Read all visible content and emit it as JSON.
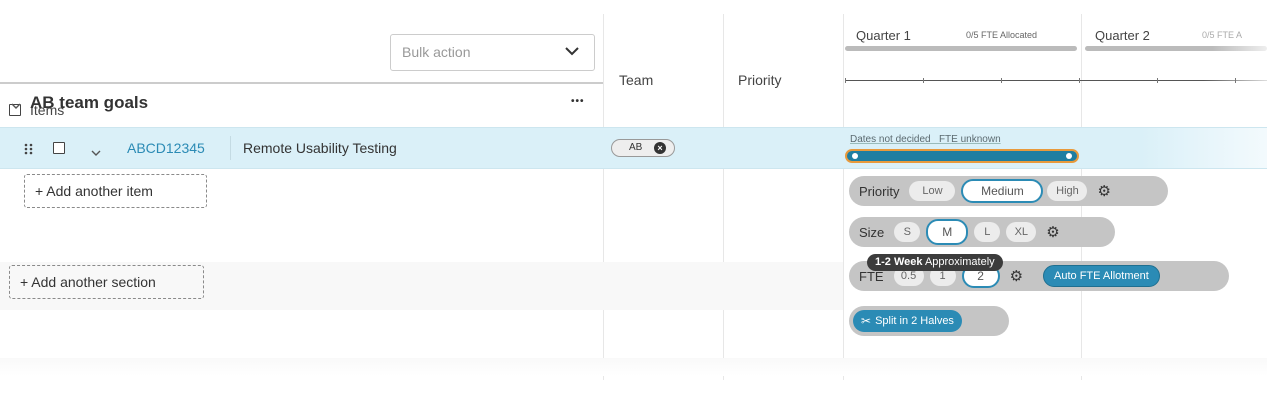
{
  "header": {
    "items_label": "Items",
    "bulk_action_placeholder": "Bulk action",
    "team_label": "Team",
    "priority_label": "Priority",
    "quarters": [
      {
        "label": "Quarter 1",
        "fte": "0/5 FTE Allocated"
      },
      {
        "label": "Quarter 2",
        "fte": "0/5 FTE A"
      }
    ]
  },
  "section": {
    "title": "AB team goals",
    "menu": "•••"
  },
  "row": {
    "id": "ABCD12345",
    "title": "Remote Usability Testing",
    "team_tag": "AB",
    "timeline_note": "Dates not decided   FTE unknown"
  },
  "actions": {
    "add_item": "+ Add another item",
    "add_section": "+ Add another section"
  },
  "popover": {
    "priority": {
      "label": "Priority",
      "options": [
        "Low",
        "Medium",
        "High"
      ],
      "selected": "Medium"
    },
    "size": {
      "label": "Size",
      "options": [
        "S",
        "M",
        "L",
        "XL"
      ],
      "selected": "M"
    },
    "fte": {
      "label": "FTE",
      "options": [
        "0.5",
        "1",
        "2"
      ],
      "selected": "2"
    },
    "tooltip_bold": "1-2 Week",
    "tooltip_rest": " Approximately",
    "auto_fte": "Auto FTE Allotment",
    "split": "Split in 2 Halves"
  },
  "colors": {
    "accent": "#2b8bb5",
    "row_highlight": "#daf0f8",
    "bar_fill": "#1f7ea1",
    "bar_border": "#e89a3c"
  }
}
